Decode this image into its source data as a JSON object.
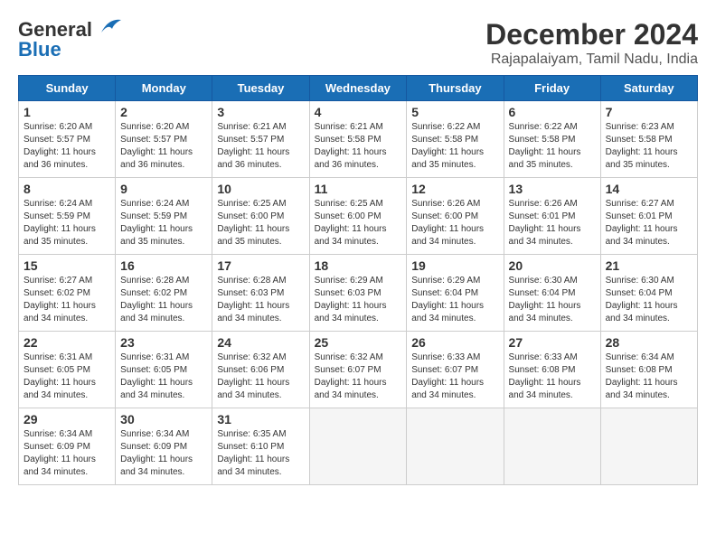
{
  "logo": {
    "line1": "General",
    "line2": "Blue"
  },
  "title": "December 2024",
  "subtitle": "Rajapalaiyam, Tamil Nadu, India",
  "weekdays": [
    "Sunday",
    "Monday",
    "Tuesday",
    "Wednesday",
    "Thursday",
    "Friday",
    "Saturday"
  ],
  "weeks": [
    [
      {
        "day": "1",
        "info": "Sunrise: 6:20 AM\nSunset: 5:57 PM\nDaylight: 11 hours\nand 36 minutes."
      },
      {
        "day": "2",
        "info": "Sunrise: 6:20 AM\nSunset: 5:57 PM\nDaylight: 11 hours\nand 36 minutes."
      },
      {
        "day": "3",
        "info": "Sunrise: 6:21 AM\nSunset: 5:57 PM\nDaylight: 11 hours\nand 36 minutes."
      },
      {
        "day": "4",
        "info": "Sunrise: 6:21 AM\nSunset: 5:58 PM\nDaylight: 11 hours\nand 36 minutes."
      },
      {
        "day": "5",
        "info": "Sunrise: 6:22 AM\nSunset: 5:58 PM\nDaylight: 11 hours\nand 35 minutes."
      },
      {
        "day": "6",
        "info": "Sunrise: 6:22 AM\nSunset: 5:58 PM\nDaylight: 11 hours\nand 35 minutes."
      },
      {
        "day": "7",
        "info": "Sunrise: 6:23 AM\nSunset: 5:58 PM\nDaylight: 11 hours\nand 35 minutes."
      }
    ],
    [
      {
        "day": "8",
        "info": "Sunrise: 6:24 AM\nSunset: 5:59 PM\nDaylight: 11 hours\nand 35 minutes."
      },
      {
        "day": "9",
        "info": "Sunrise: 6:24 AM\nSunset: 5:59 PM\nDaylight: 11 hours\nand 35 minutes."
      },
      {
        "day": "10",
        "info": "Sunrise: 6:25 AM\nSunset: 6:00 PM\nDaylight: 11 hours\nand 35 minutes."
      },
      {
        "day": "11",
        "info": "Sunrise: 6:25 AM\nSunset: 6:00 PM\nDaylight: 11 hours\nand 34 minutes."
      },
      {
        "day": "12",
        "info": "Sunrise: 6:26 AM\nSunset: 6:00 PM\nDaylight: 11 hours\nand 34 minutes."
      },
      {
        "day": "13",
        "info": "Sunrise: 6:26 AM\nSunset: 6:01 PM\nDaylight: 11 hours\nand 34 minutes."
      },
      {
        "day": "14",
        "info": "Sunrise: 6:27 AM\nSunset: 6:01 PM\nDaylight: 11 hours\nand 34 minutes."
      }
    ],
    [
      {
        "day": "15",
        "info": "Sunrise: 6:27 AM\nSunset: 6:02 PM\nDaylight: 11 hours\nand 34 minutes."
      },
      {
        "day": "16",
        "info": "Sunrise: 6:28 AM\nSunset: 6:02 PM\nDaylight: 11 hours\nand 34 minutes."
      },
      {
        "day": "17",
        "info": "Sunrise: 6:28 AM\nSunset: 6:03 PM\nDaylight: 11 hours\nand 34 minutes."
      },
      {
        "day": "18",
        "info": "Sunrise: 6:29 AM\nSunset: 6:03 PM\nDaylight: 11 hours\nand 34 minutes."
      },
      {
        "day": "19",
        "info": "Sunrise: 6:29 AM\nSunset: 6:04 PM\nDaylight: 11 hours\nand 34 minutes."
      },
      {
        "day": "20",
        "info": "Sunrise: 6:30 AM\nSunset: 6:04 PM\nDaylight: 11 hours\nand 34 minutes."
      },
      {
        "day": "21",
        "info": "Sunrise: 6:30 AM\nSunset: 6:04 PM\nDaylight: 11 hours\nand 34 minutes."
      }
    ],
    [
      {
        "day": "22",
        "info": "Sunrise: 6:31 AM\nSunset: 6:05 PM\nDaylight: 11 hours\nand 34 minutes."
      },
      {
        "day": "23",
        "info": "Sunrise: 6:31 AM\nSunset: 6:05 PM\nDaylight: 11 hours\nand 34 minutes."
      },
      {
        "day": "24",
        "info": "Sunrise: 6:32 AM\nSunset: 6:06 PM\nDaylight: 11 hours\nand 34 minutes."
      },
      {
        "day": "25",
        "info": "Sunrise: 6:32 AM\nSunset: 6:07 PM\nDaylight: 11 hours\nand 34 minutes."
      },
      {
        "day": "26",
        "info": "Sunrise: 6:33 AM\nSunset: 6:07 PM\nDaylight: 11 hours\nand 34 minutes."
      },
      {
        "day": "27",
        "info": "Sunrise: 6:33 AM\nSunset: 6:08 PM\nDaylight: 11 hours\nand 34 minutes."
      },
      {
        "day": "28",
        "info": "Sunrise: 6:34 AM\nSunset: 6:08 PM\nDaylight: 11 hours\nand 34 minutes."
      }
    ],
    [
      {
        "day": "29",
        "info": "Sunrise: 6:34 AM\nSunset: 6:09 PM\nDaylight: 11 hours\nand 34 minutes."
      },
      {
        "day": "30",
        "info": "Sunrise: 6:34 AM\nSunset: 6:09 PM\nDaylight: 11 hours\nand 34 minutes."
      },
      {
        "day": "31",
        "info": "Sunrise: 6:35 AM\nSunset: 6:10 PM\nDaylight: 11 hours\nand 34 minutes."
      },
      null,
      null,
      null,
      null
    ]
  ]
}
